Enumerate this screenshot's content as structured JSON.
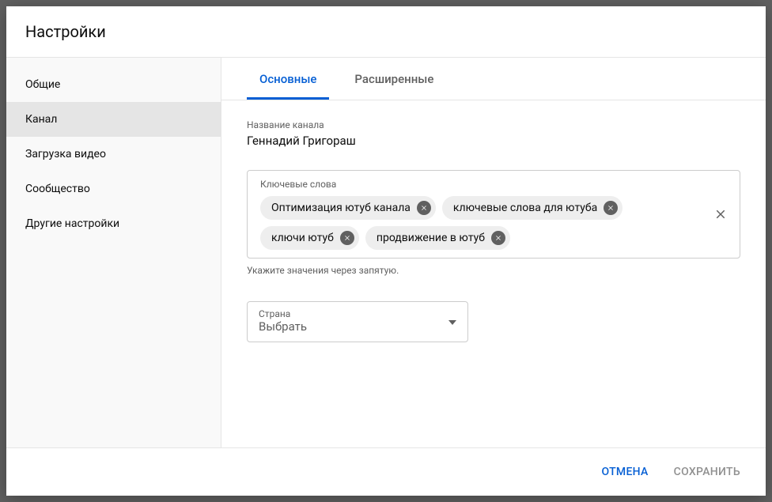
{
  "dialog": {
    "title": "Настройки"
  },
  "sidebar": {
    "items": [
      {
        "label": "Общие"
      },
      {
        "label": "Канал"
      },
      {
        "label": "Загрузка видео"
      },
      {
        "label": "Сообщество"
      },
      {
        "label": "Другие настройки"
      }
    ],
    "activeIndex": 1
  },
  "tabs": {
    "items": [
      {
        "label": "Основные"
      },
      {
        "label": "Расширенные"
      }
    ],
    "activeIndex": 0
  },
  "channel": {
    "name_label": "Название канала",
    "name_value": "Геннадий Григораш"
  },
  "keywords": {
    "label": "Ключевые слова",
    "chips": [
      "Оптимизация ютуб канала",
      "ключевые слова для ютуба",
      "ключи ютуб",
      "продвижение в ютуб"
    ],
    "hint": "Укажите значения через запятую."
  },
  "country": {
    "label": "Страна",
    "value": "Выбрать"
  },
  "footer": {
    "cancel": "ОТМЕНА",
    "save": "СОХРАНИТЬ"
  }
}
